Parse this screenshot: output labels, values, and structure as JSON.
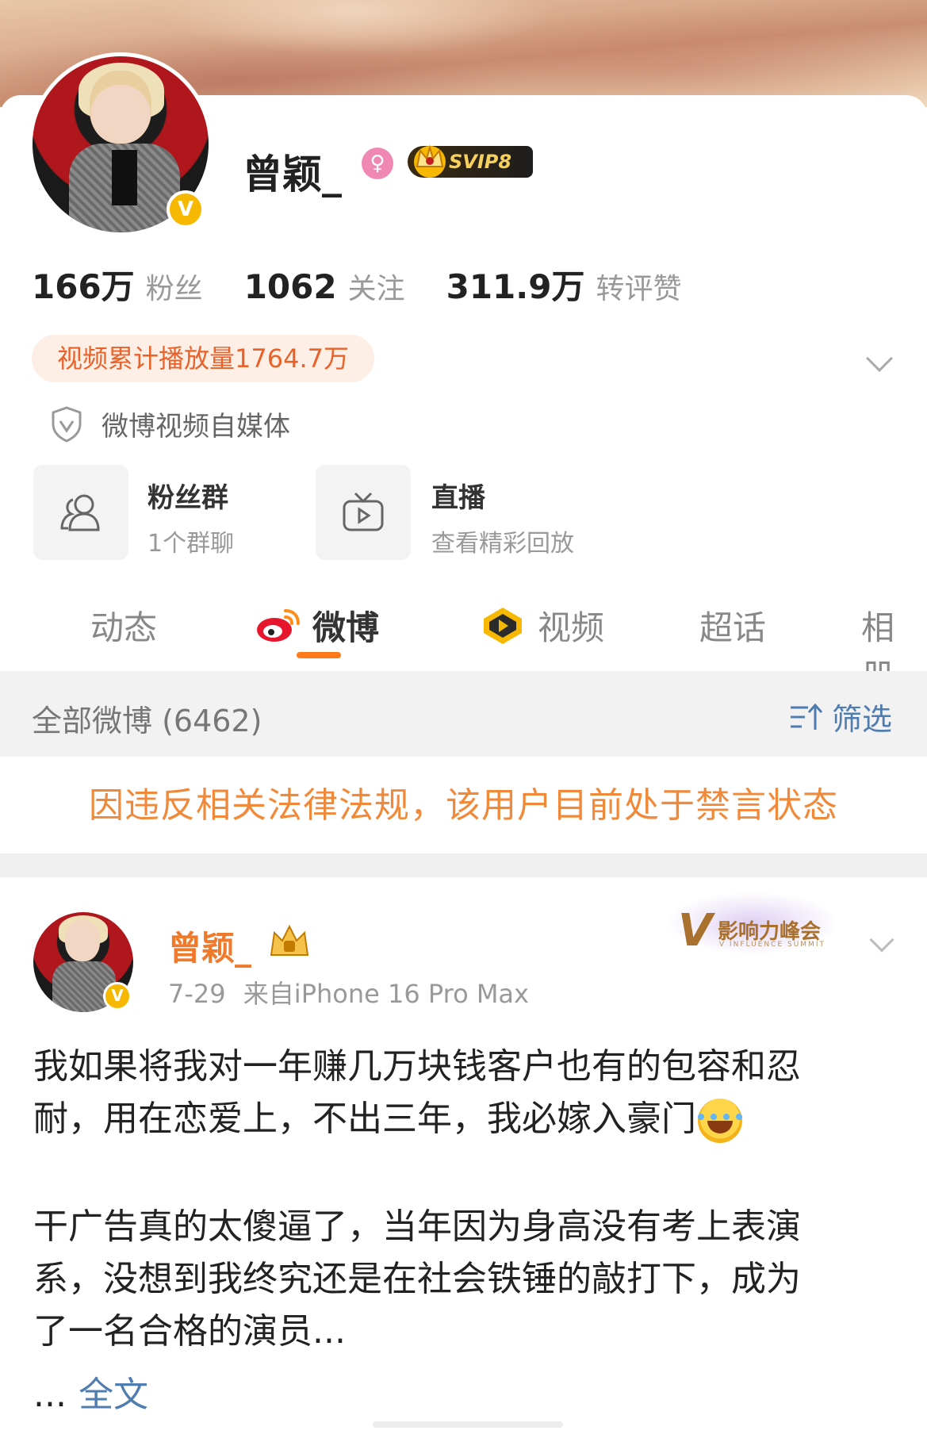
{
  "profile": {
    "name": "曾颖_",
    "gender_icon": "female-icon",
    "svip_label": "SVIP8",
    "verified_badge": "V"
  },
  "stats": [
    {
      "num": "166万",
      "label": "粉丝"
    },
    {
      "num": "1062",
      "label": "关注"
    },
    {
      "num": "311.9万",
      "label": "转评赞"
    }
  ],
  "video_play_count": "视频累计播放量1764.7万",
  "certification": "微博视频自媒体",
  "quick_links": [
    {
      "title": "粉丝群",
      "sub": "1个群聊",
      "icon": "group-icon"
    },
    {
      "title": "直播",
      "sub": "查看精彩回放",
      "icon": "tv-icon"
    }
  ],
  "tabs": [
    {
      "label": "动态",
      "active": false
    },
    {
      "label": "微博",
      "active": true,
      "icon": "weibo-icon"
    },
    {
      "label": "视频",
      "active": false,
      "icon": "video-play-icon"
    },
    {
      "label": "超话",
      "active": false
    },
    {
      "label": "相册",
      "active": false
    }
  ],
  "filter_bar": {
    "all_label": "全部微博 (6462)",
    "filter_label": "筛选"
  },
  "ban_notice": "因违反相关法律法规，该用户目前处于禁言状态",
  "post": {
    "author": "曾颖_",
    "time": "7-29",
    "source": "来自iPhone 16 Pro Max",
    "badge": {
      "mark": "V",
      "title": "影响力峰会",
      "sub": "V INFLUENCE SUMMIT"
    },
    "paragraph1_line1": "我如果将我对一年赚几万块钱客户也有的包容和忍",
    "paragraph1_line2": "耐，用在恋爱上，不出三年，我必嫁入豪门",
    "paragraph2_line1": "干广告真的太傻逼了，当年因为身高没有考上表演",
    "paragraph2_line2": "系，没想到我终究还是在社会铁锤的敲打下，成为",
    "paragraph2_line3": "了一名合格的演员...",
    "ellipsis": "...",
    "full_text_link": "全文"
  },
  "colors": {
    "accent_orange": "#ff7a1a",
    "link_blue": "#507daf",
    "ban_orange": "#f08a3a",
    "gold": "#f6b800"
  }
}
